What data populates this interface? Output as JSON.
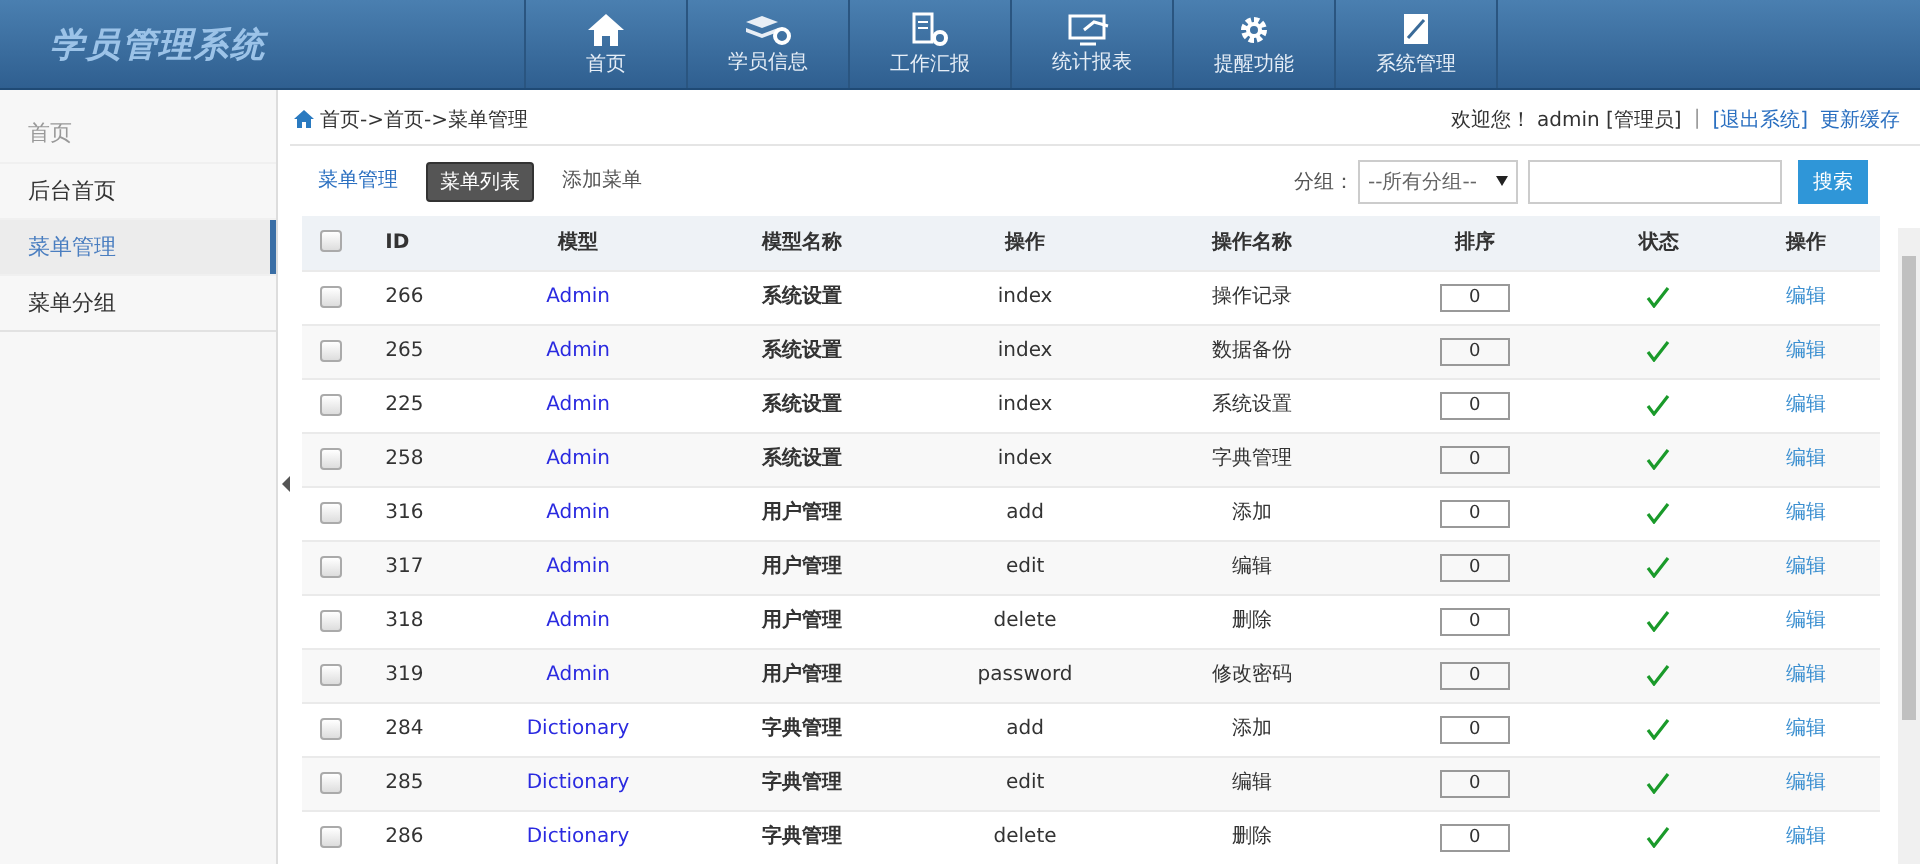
{
  "header": {
    "logo": "学员管理系统",
    "nav": [
      {
        "label": "首页"
      },
      {
        "label": "学员信息"
      },
      {
        "label": "工作汇报"
      },
      {
        "label": "统计报表"
      },
      {
        "label": "提醒功能"
      },
      {
        "label": "系统管理"
      }
    ]
  },
  "sidebar": {
    "heading": "首页",
    "items": [
      {
        "label": "后台首页",
        "selected": false
      },
      {
        "label": "菜单管理",
        "selected": true
      },
      {
        "label": "菜单分组",
        "selected": false
      }
    ]
  },
  "breadcrumb": "首页->首页->菜单管理",
  "user_bar": {
    "welcome": "欢迎您！ admin [管理员]",
    "separator": "|",
    "logout": "[退出系统]",
    "refresh": "更新缓存"
  },
  "tabs": [
    {
      "label": "菜单管理",
      "kind": "link",
      "selected": false
    },
    {
      "label": "菜单列表",
      "kind": "pill",
      "selected": true
    },
    {
      "label": "添加菜单",
      "kind": "plain",
      "selected": false
    }
  ],
  "filter": {
    "label": "分组：",
    "select": "--所有分组--",
    "search_button": "搜索"
  },
  "table": {
    "select_all_checked": false,
    "columns": [
      "ID",
      "模型",
      "模型名称",
      "操作",
      "操作名称",
      "排序",
      "状态",
      "操作"
    ],
    "rows": [
      {
        "checked": false,
        "id": "266",
        "model": "Admin",
        "model_name": "系统设置",
        "action": "index",
        "action_name": "操作记录",
        "sort": "0",
        "on": true,
        "edit": "编辑"
      },
      {
        "checked": false,
        "id": "265",
        "model": "Admin",
        "model_name": "系统设置",
        "action": "index",
        "action_name": "数据备份",
        "sort": "0",
        "on": true,
        "edit": "编辑"
      },
      {
        "checked": false,
        "id": "225",
        "model": "Admin",
        "model_name": "系统设置",
        "action": "index",
        "action_name": "系统设置",
        "sort": "0",
        "on": true,
        "edit": "编辑"
      },
      {
        "checked": false,
        "id": "258",
        "model": "Admin",
        "model_name": "系统设置",
        "action": "index",
        "action_name": "字典管理",
        "sort": "0",
        "on": true,
        "edit": "编辑"
      },
      {
        "checked": false,
        "id": "316",
        "model": "Admin",
        "model_name": "用户管理",
        "action": "add",
        "action_name": "添加",
        "sort": "0",
        "on": true,
        "edit": "编辑"
      },
      {
        "checked": false,
        "id": "317",
        "model": "Admin",
        "model_name": "用户管理",
        "action": "edit",
        "action_name": "编辑",
        "sort": "0",
        "on": true,
        "edit": "编辑"
      },
      {
        "checked": false,
        "id": "318",
        "model": "Admin",
        "model_name": "用户管理",
        "action": "delete",
        "action_name": "删除",
        "sort": "0",
        "on": true,
        "edit": "编辑"
      },
      {
        "checked": false,
        "id": "319",
        "model": "Admin",
        "model_name": "用户管理",
        "action": "password",
        "action_name": "修改密码",
        "sort": "0",
        "on": true,
        "edit": "编辑"
      },
      {
        "checked": false,
        "id": "284",
        "model": "Dictionary",
        "model_name": "字典管理",
        "action": "add",
        "action_name": "添加",
        "sort": "0",
        "on": true,
        "edit": "编辑"
      },
      {
        "checked": false,
        "id": "285",
        "model": "Dictionary",
        "model_name": "字典管理",
        "action": "edit",
        "action_name": "编辑",
        "sort": "0",
        "on": true,
        "edit": "编辑"
      },
      {
        "checked": false,
        "id": "286",
        "model": "Dictionary",
        "model_name": "字典管理",
        "action": "delete",
        "action_name": "删除",
        "sort": "0",
        "on": true,
        "edit": "编辑"
      }
    ]
  }
}
